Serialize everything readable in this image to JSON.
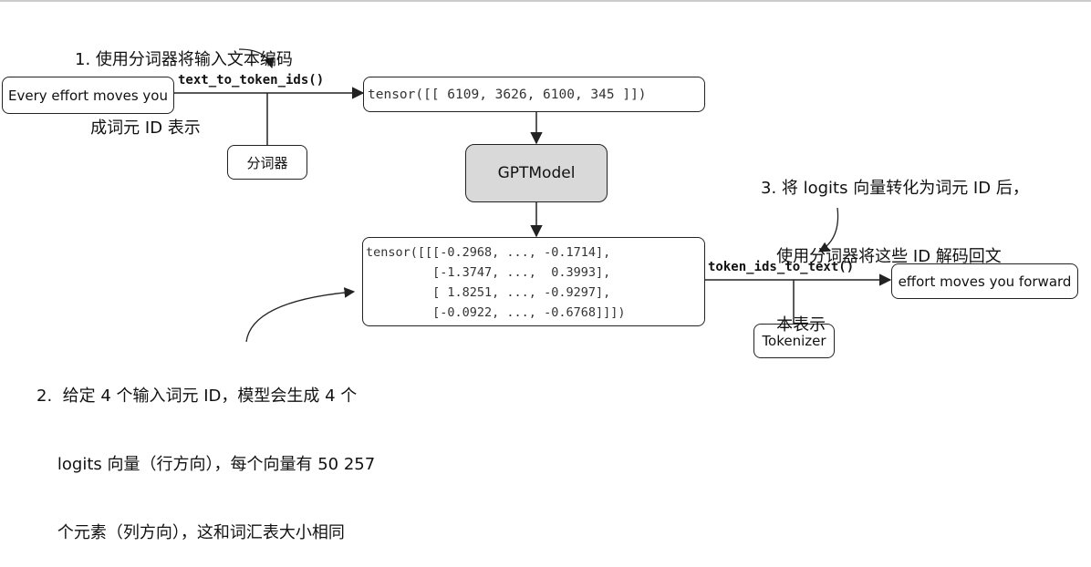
{
  "input_box": {
    "text": "Every effort moves you"
  },
  "encode_function": {
    "label": "text_to_token_ids()"
  },
  "tokenizer_left": {
    "label": "分词器"
  },
  "token_ids_box": {
    "text": "tensor([[ 6109, 3626, 6100, 345 ]])"
  },
  "model_box": {
    "label": "GPTModel"
  },
  "logits_box": {
    "lines": [
      "tensor([[[-0.2968, ..., -0.1714],",
      "         [-1.3747, ...,  0.3993],",
      "         [ 1.8251, ..., -0.9297],",
      "         [-0.0922, ..., -0.6768]]])"
    ]
  },
  "decode_function": {
    "label": "token_ids_to_text()"
  },
  "output_box": {
    "text": "effort moves you forward"
  },
  "tokenizer_right": {
    "label": "Tokenizer"
  },
  "annotations": {
    "step1": {
      "lines": [
        "1. 使用分词器将输入文本编码",
        "   成词元 ID 表示"
      ]
    },
    "step2": {
      "lines": [
        "2.  给定 4 个输入词元 ID，模型会生成 4 个",
        "    logits 向量（行方向），每个向量有 50 257",
        "    个元素（列方向），这和词汇表大小相同"
      ]
    },
    "step3": {
      "lines": [
        "3. 将 logits 向量转化为词元 ID 后，",
        "   使用分词器将这些 ID 解码回文",
        "   本表示"
      ]
    }
  },
  "colors": {
    "stroke": "#222222",
    "model_fill": "#d9d9d9",
    "background": "#ffffff"
  }
}
